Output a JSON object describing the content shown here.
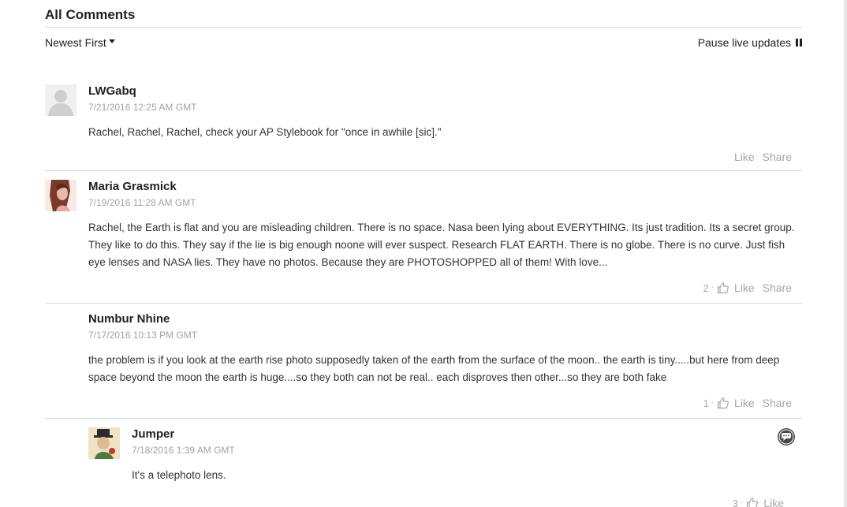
{
  "header": {
    "title": "All Comments",
    "sort_label": "Newest First",
    "pause_label": "Pause live updates"
  },
  "comments": [
    {
      "author": "LWGabq",
      "timestamp": "7/21/2016 12:25 AM GMT",
      "text": "Rachel, Rachel, Rachel, check your AP Stylebook for \"once in awhile [sic].\"",
      "like_label": "Like",
      "share_label": "Share",
      "likes": ""
    },
    {
      "author": "Maria Grasmick",
      "timestamp": "7/19/2016 11:28 AM GMT",
      "text": "Rachel, the Earth is flat and you are misleading children. There is no space. Nasa been lying about EVERYTHING. Its just tradition. Its a secret group. They like to do this. They say if the lie is big enough noone will ever suspect. Research FLAT EARTH. There is no globe. There is no curve. Just fish eye lenses and NASA lies. They have no photos. Because they are PHOTOSHOPPED all of them! With love...",
      "like_label": "Like",
      "share_label": "Share",
      "likes": "2"
    },
    {
      "author": "Numbur Nhine",
      "timestamp": "7/17/2016 10:13 PM GMT",
      "text": "the problem is if you look at the earth rise photo supposedly taken of the earth from the surface of the moon.. the earth is tiny.....but here from deep space beyond the moon the earth is huge....so they both can not be real.. each disproves then other...so they are both fake",
      "like_label": "Like",
      "share_label": "Share",
      "likes": "1"
    },
    {
      "author": "Jumper",
      "timestamp": "7/18/2016 1:39 AM GMT",
      "text": "It's a telephoto lens.",
      "like_label": "Like",
      "likes": "3"
    }
  ],
  "colors": {
    "muted": "#a6a6a6",
    "divider": "#d6d6d6",
    "text": "#333333"
  }
}
